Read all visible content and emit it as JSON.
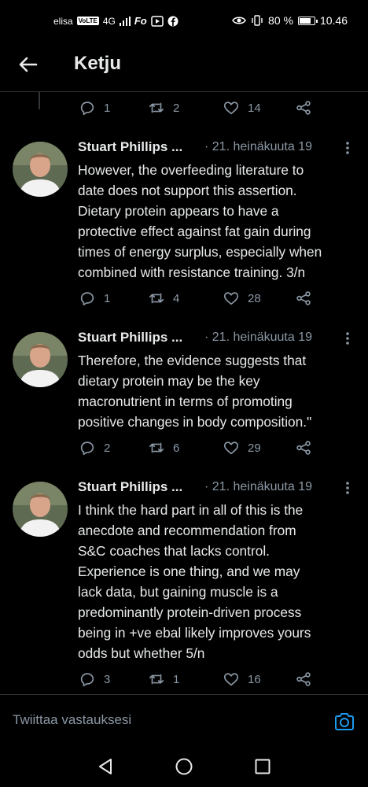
{
  "status_bar": {
    "carrier": "elisa",
    "volte": "VoLTE",
    "network": "4G",
    "app_labels": "Fo",
    "battery_percent": "80 %",
    "battery_level": 0.8,
    "time": "10.46"
  },
  "header": {
    "title": "Ketju"
  },
  "top_actions": {
    "replies": "1",
    "retweets": "2",
    "likes": "14"
  },
  "tweets": [
    {
      "name": "Stuart Phillips ...",
      "date": "· 21. heinäkuuta 19",
      "text": "However, the overfeeding literature to\ndate does not support this assertion.\nDietary protein appears to have a\nprotective effect against fat gain during\ntimes of energy surplus, especially when\ncombined with resistance training. 3/n",
      "replies": "1",
      "retweets": "4",
      "likes": "28"
    },
    {
      "name": "Stuart Phillips ...",
      "date": "· 21. heinäkuuta 19",
      "text": "Therefore, the evidence suggests that\ndietary protein may be the key\nmacronutrient in terms of promoting\npositive changes in body composition.\"",
      "replies": "2",
      "retweets": "6",
      "likes": "29"
    },
    {
      "name": "Stuart Phillips ...",
      "date": "· 21. heinäkuuta 19",
      "text": "I think the hard part in all of this is the\nanecdote and recommendation from\nS&C coaches that lacks control.\nExperience is one thing, and we may\nlack data, but gaining muscle is a\npredominantly protein-driven process\nbeing in +ve ebal likely improves yours\nodds but whether 5/n",
      "replies": "3",
      "retweets": "1",
      "likes": "16"
    }
  ],
  "reply_bar": {
    "placeholder": "Twiittaa vastauksesi"
  },
  "colors": {
    "background": "#000000",
    "text": "#e7e9ea",
    "muted": "#8b98a5",
    "accent": "#1d9bf0",
    "divider": "#2f3336"
  },
  "icons": [
    "back-arrow-icon",
    "reply-icon",
    "retweet-icon",
    "like-icon",
    "share-icon",
    "more-icon",
    "camera-icon",
    "nav-back-icon",
    "nav-home-icon",
    "nav-recents-icon"
  ]
}
